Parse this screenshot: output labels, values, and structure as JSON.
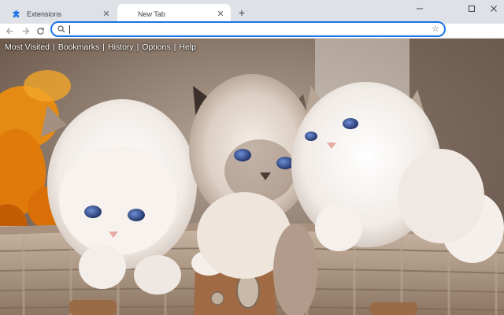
{
  "tabs": [
    {
      "title": "Extensions",
      "icon": "puzzle-piece-icon",
      "active": false
    },
    {
      "title": "New Tab",
      "icon": "",
      "active": true
    }
  ],
  "address_bar": {
    "value": "",
    "placeholder": ""
  },
  "nav_links": [
    "Most Visited",
    "Bookmarks",
    "History",
    "Options",
    "Help"
  ],
  "link_separator": "|",
  "colors": {
    "accent": "#1a73e8",
    "tabstrip": "#dee1e6",
    "extension_icon": "#e8b84a"
  },
  "background": {
    "subject": "three white kittens in a wicker basket"
  }
}
